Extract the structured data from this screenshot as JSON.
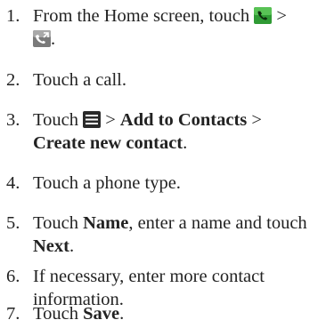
{
  "steps": [
    {
      "number": "1.",
      "text_before": "From the Home screen, touch",
      "sep": ">",
      "icon1": "phone-app-icon",
      "icon2": "call-log-icon",
      "end": "."
    },
    {
      "number": "2.",
      "text": "Touch a call."
    },
    {
      "number": "3.",
      "text_before": "Touch",
      "icon": "menu-icon",
      "sep1": ">",
      "bold1": "Add to Contacts",
      "sep2": ">",
      "bold2": "Create new contact",
      "end": "."
    },
    {
      "number": "4.",
      "text": "Touch a phone type."
    },
    {
      "number": "5.",
      "text_before": "Touch",
      "bold1": "Name",
      "text_mid": ", enter a name and touch",
      "bold2": "Next",
      "end": "."
    },
    {
      "number": "6.",
      "text": "If necessary, enter more contact information."
    },
    {
      "number": "7.",
      "text_before": "Touch",
      "bold1": "Save",
      "end": "."
    }
  ],
  "colors": {
    "text": "#222222",
    "phone_icon_green": "#3daa3a",
    "menu_icon": "#2a2a2a"
  }
}
